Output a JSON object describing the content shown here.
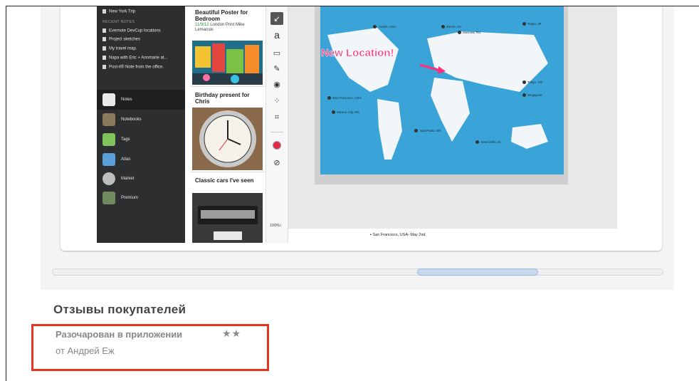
{
  "sidebar": {
    "trip": "New York Trip",
    "recent_heading": "RECENT NOTES",
    "recent": [
      "Evernote DevCup locations",
      "Project sketches",
      "My travel map.",
      "Napa with Eric + Annmarie at...",
      "Post-it® Note from the office."
    ],
    "items": [
      "Notes",
      "Notebooks",
      "Tags",
      "Atlas",
      "Market",
      "Premium"
    ]
  },
  "notes_list": [
    {
      "title": "Beautiful  Poster for Bedroom",
      "date": "11/9/12",
      "meta": " London Print Mike Lemanski"
    },
    {
      "title": "Birthday present for Chris"
    },
    {
      "title": "Classic cars I've seen"
    }
  ],
  "toolbar": {
    "text_tool": "a",
    "zoom": "100%↕"
  },
  "map": {
    "callout": "New Location!",
    "cities": [
      "Austin, USA",
      "Zürich, CH",
      "Moscow, RU",
      "Tokyo, JP",
      "San Francisco, USA",
      "Mexico City, MX",
      "Sao Paulo, BR",
      "New Delhi, IN",
      "Singapore",
      "Tokyo, TW"
    ]
  },
  "note_body_line": "San Francisco, USA- May 2nd",
  "reviews": {
    "heading": "Отзывы покупателей",
    "items": [
      {
        "title": "Разочарован в приложении",
        "stars": "★★",
        "author": "от Андрей Еж",
        "rating": 2
      }
    ]
  }
}
